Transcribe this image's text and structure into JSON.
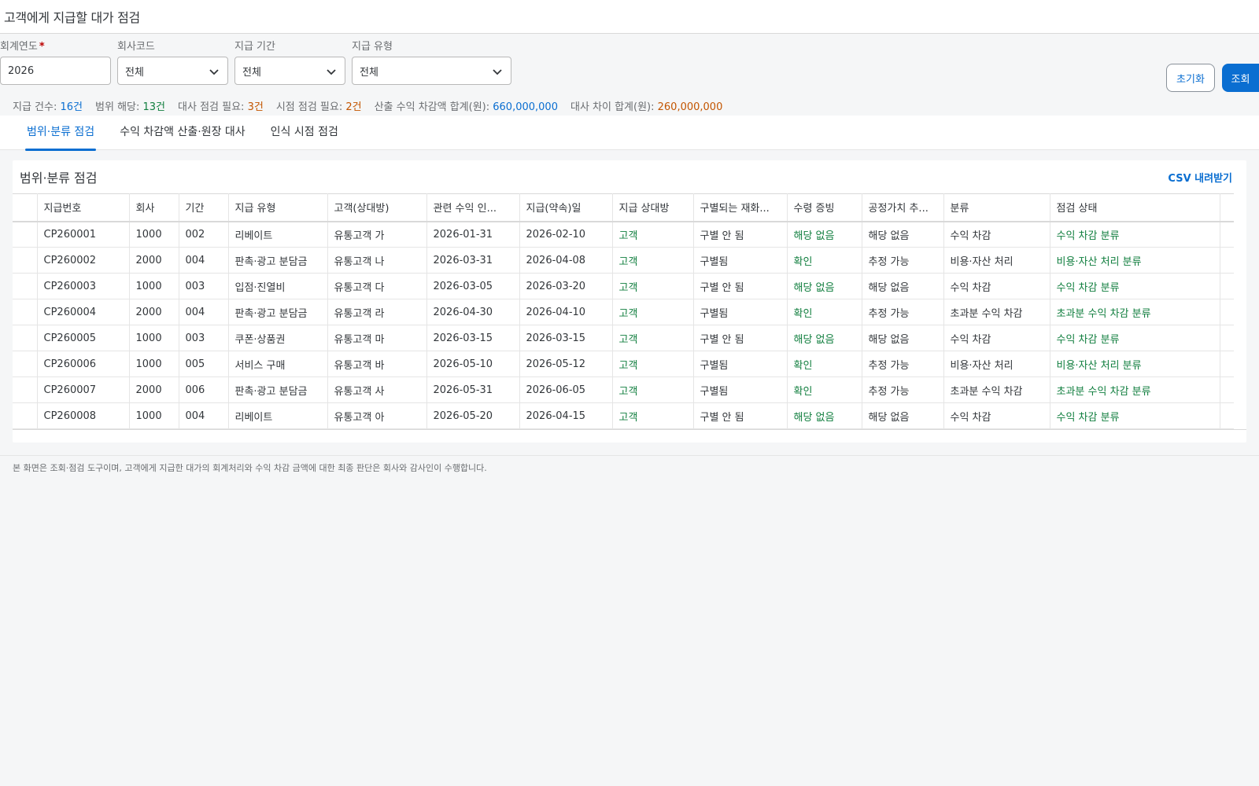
{
  "header": {
    "title": "고객에게 지급할 대가 점검"
  },
  "filters": {
    "fiscal_year": {
      "label": "회계연도",
      "required_mark": "*",
      "value": "2026"
    },
    "company_code": {
      "label": "회사코드",
      "value": "전체"
    },
    "period": {
      "label": "지급 기간",
      "value": "전체"
    },
    "payment_type": {
      "label": "지급 유형",
      "value": "전체"
    }
  },
  "buttons": {
    "reset": "초기화",
    "search": "조회"
  },
  "summary": [
    {
      "label": "지급 건수:",
      "value": "16건",
      "tone": "blue"
    },
    {
      "label": "범위 해당:",
      "value": "13건",
      "tone": "green"
    },
    {
      "label": "대사 점검 필요:",
      "value": "3건",
      "tone": "orange"
    },
    {
      "label": "시점 점검 필요:",
      "value": "2건",
      "tone": "orange"
    },
    {
      "label": "산출 수익 차감액 합계(원):",
      "value": "660,000,000",
      "tone": "blue"
    },
    {
      "label": "대사 차이 합계(원):",
      "value": "260,000,000",
      "tone": "orange"
    }
  ],
  "tabs": [
    {
      "label": "범위·분류 점검",
      "active": true
    },
    {
      "label": "수익 차감액 산출·원장 대사",
      "active": false
    },
    {
      "label": "인식 시점 점검",
      "active": false
    }
  ],
  "panel": {
    "title": "범위·분류 점검",
    "csv_label": "CSV 내려받기"
  },
  "table": {
    "columns": [
      "지급번호",
      "회사",
      "기간",
      "지급 유형",
      "고객(상대방)",
      "관련 수익 인...",
      "지급(약속)일",
      "지급 상대방",
      "구별되는 재화...",
      "수령 증빙",
      "공정가치 추...",
      "분류",
      "점검 상태"
    ],
    "rows": [
      [
        "CP260001",
        "1000",
        "002",
        "리베이트",
        "유통고객 가",
        "2026-01-31",
        "2026-02-10",
        "고객",
        "구별 안 됨",
        "해당 없음",
        "해당 없음",
        "수익 차감",
        "수익 차감 분류"
      ],
      [
        "CP260002",
        "2000",
        "004",
        "판촉·광고 분담금",
        "유통고객 나",
        "2026-03-31",
        "2026-04-08",
        "고객",
        "구별됨",
        "확인",
        "추정 가능",
        "비용·자산 처리",
        "비용·자산 처리 분류"
      ],
      [
        "CP260003",
        "1000",
        "003",
        "입점·진열비",
        "유통고객 다",
        "2026-03-05",
        "2026-03-20",
        "고객",
        "구별 안 됨",
        "해당 없음",
        "해당 없음",
        "수익 차감",
        "수익 차감 분류"
      ],
      [
        "CP260004",
        "2000",
        "004",
        "판촉·광고 분담금",
        "유통고객 라",
        "2026-04-30",
        "2026-04-10",
        "고객",
        "구별됨",
        "확인",
        "추정 가능",
        "초과분 수익 차감",
        "초과분 수익 차감 분류"
      ],
      [
        "CP260005",
        "1000",
        "003",
        "쿠폰·상품권",
        "유통고객 마",
        "2026-03-15",
        "2026-03-15",
        "고객",
        "구별 안 됨",
        "해당 없음",
        "해당 없음",
        "수익 차감",
        "수익 차감 분류"
      ],
      [
        "CP260006",
        "1000",
        "005",
        "서비스 구매",
        "유통고객 바",
        "2026-05-10",
        "2026-05-12",
        "고객",
        "구별됨",
        "확인",
        "추정 가능",
        "비용·자산 처리",
        "비용·자산 처리 분류"
      ],
      [
        "CP260007",
        "2000",
        "006",
        "판촉·광고 분담금",
        "유통고객 사",
        "2026-05-31",
        "2026-06-05",
        "고객",
        "구별됨",
        "확인",
        "추정 가능",
        "초과분 수익 차감",
        "초과분 수익 차감 분류"
      ],
      [
        "CP260008",
        "1000",
        "004",
        "리베이트",
        "유통고객 아",
        "2026-05-20",
        "2026-04-15",
        "고객",
        "구별 안 됨",
        "해당 없음",
        "해당 없음",
        "수익 차감",
        "수익 차감 분류"
      ]
    ]
  },
  "footnote": "본 화면은 조회·점검 도구이며, 고객에게 지급한 대가의 회계처리와 수익 차감 금액에 대한 최종 판단은 회사와 감사인이 수행합니다.",
  "colors": {
    "accent": "#0a6ed1",
    "positive": "#107e3e",
    "warning": "#c35500"
  }
}
